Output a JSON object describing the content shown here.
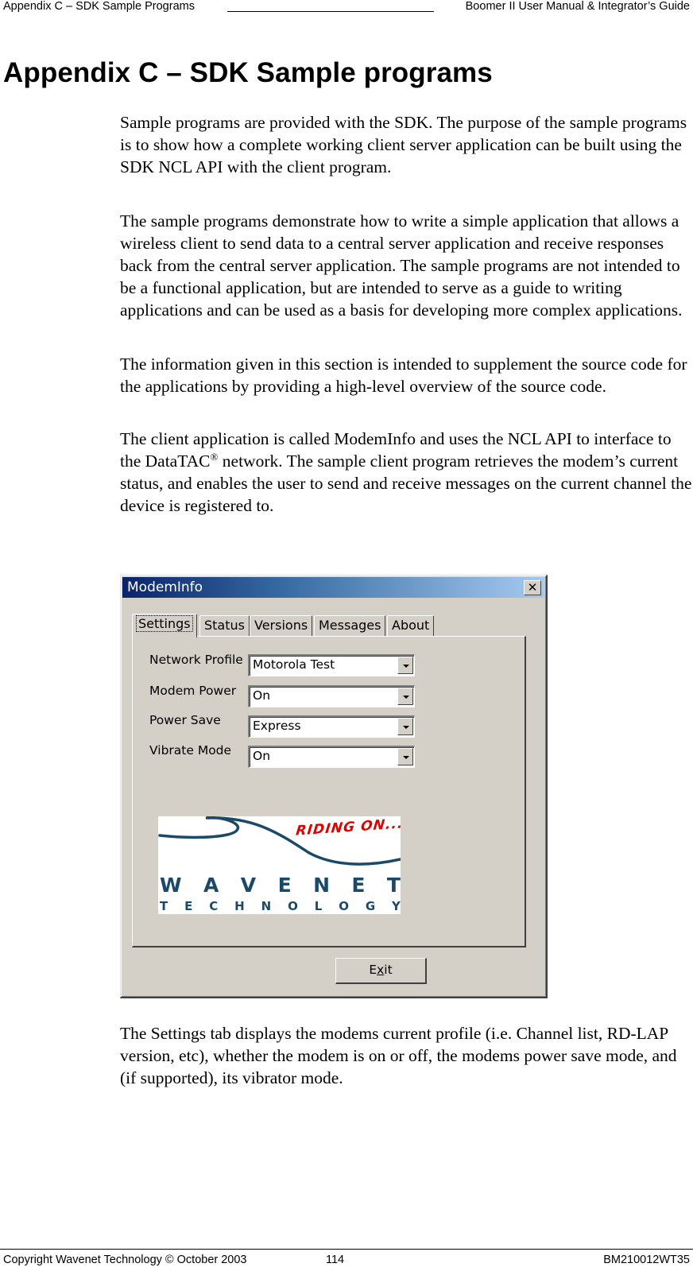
{
  "header": {
    "left": "Appendix C – SDK Sample Programs",
    "right": "Boomer II User Manual & Integrator’s Guide"
  },
  "title": "Appendix C – SDK Sample programs",
  "paragraphs": {
    "p1": "Sample programs are provided with the SDK. The purpose of the sample programs is to show how a complete working client server application can be built using the SDK NCL API with the client program.",
    "p2": "The sample programs demonstrate how to write a simple application that allows a wireless client to send data to a central server application and receive responses back from the central server application. The sample programs are not intended to be a functional application, but are intended to serve as a guide to writing applications and can be used as a basis for developing more complex applications.",
    "p3": "The information given in this section is intended to supplement the source code for the applications by providing a high-level overview of the source code.",
    "p4_a": "The client application is called ModemInfo and uses the NCL API to interface to the DataTAC",
    "p4_sup": "®",
    "p4_b": " network. The sample client program retrieves the modem’s current status, and enables the user to send and receive messages on the current channel the device is registered to.",
    "p5": "The Settings tab displays the modems current profile (i.e. Channel list, RD-LAP version, etc), whether the modem is on or off, the modems power save mode, and (if supported), its vibrator mode."
  },
  "window": {
    "title": "ModemInfo",
    "close_glyph": "✕",
    "tabs": [
      "Settings",
      "Status",
      "Versions",
      "Messages",
      "About"
    ],
    "active_tab": "Settings",
    "fields": [
      {
        "label": "Network Profile",
        "value": "Motorola Test"
      },
      {
        "label": "Modem Power",
        "value": "On"
      },
      {
        "label": "Power Save",
        "value": "Express"
      },
      {
        "label": "Vibrate Mode",
        "value": "On"
      }
    ],
    "logo": {
      "tagline": "RIDING ON...",
      "brand_letters": [
        "W",
        "A",
        "V",
        "E",
        "N",
        "E",
        "T"
      ],
      "sub_letters": [
        "T",
        "E",
        "C",
        "H",
        "N",
        "O",
        "L",
        "O",
        "G",
        "Y"
      ],
      "brand_color": "#1a4a68",
      "tagline_color": "#e00000"
    },
    "exit_label_pre": "E",
    "exit_label_ul": "x",
    "exit_label_post": "it"
  },
  "footer": {
    "left": "Copyright Wavenet Technology © October 2003",
    "page": "114",
    "right": "BM210012WT35"
  }
}
